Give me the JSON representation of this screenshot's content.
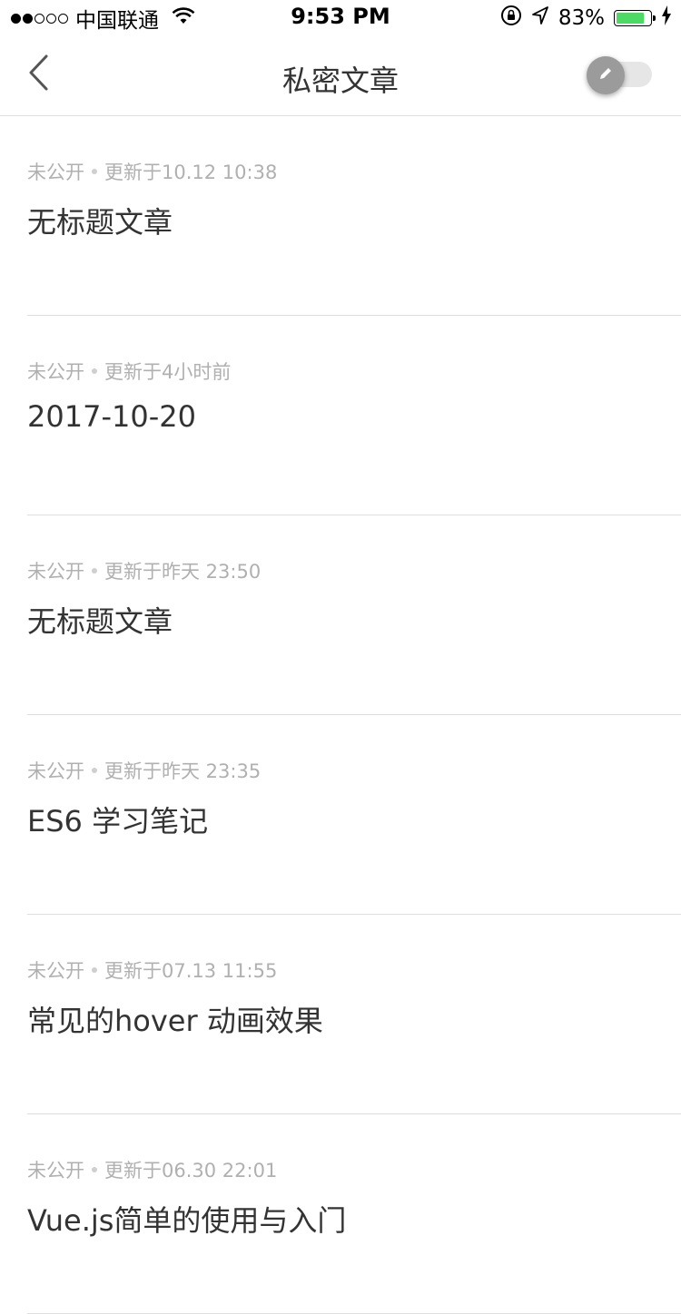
{
  "status_bar": {
    "signal_dots": [
      "full",
      "full",
      "empty",
      "empty",
      "empty"
    ],
    "carrier": "中国联通",
    "time": "9:53 PM",
    "battery_pct": "83%",
    "battery_level": 0.83,
    "battery_color": "#4cd964"
  },
  "nav": {
    "title": "私密文章",
    "back_icon": "chevron-left-icon",
    "toggle_icon": "pencil-icon"
  },
  "articles": [
    {
      "status": "未公开",
      "updated": "更新于10.12 10:38",
      "title": "无标题文章"
    },
    {
      "status": "未公开",
      "updated": "更新于4小时前",
      "title": "2017-10-20"
    },
    {
      "status": "未公开",
      "updated": "更新于昨天 23:50",
      "title": "无标题文章"
    },
    {
      "status": "未公开",
      "updated": "更新于昨天 23:35",
      "title": "ES6 学习笔记"
    },
    {
      "status": "未公开",
      "updated": "更新于07.13 11:55",
      "title": "常见的hover 动画效果"
    },
    {
      "status": "未公开",
      "updated": "更新于06.30 22:01",
      "title": "Vue.js简单的使用与入门"
    }
  ]
}
